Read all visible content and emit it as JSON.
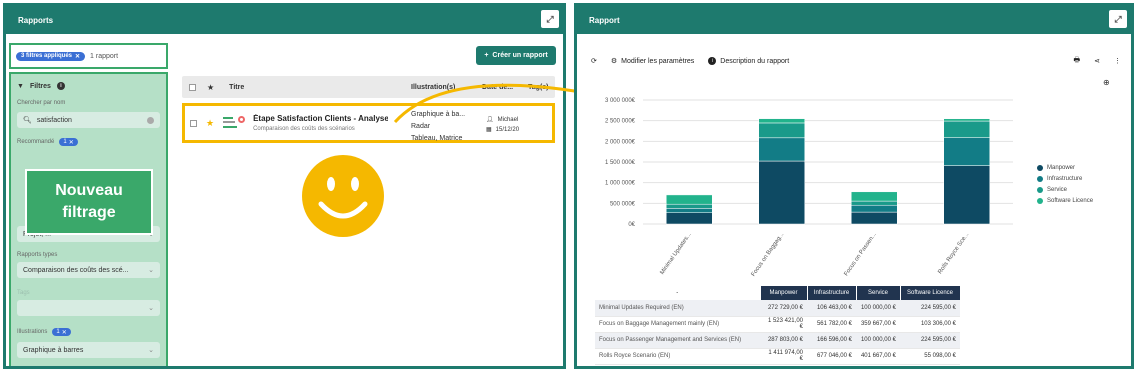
{
  "left_panel": {
    "title": "Rapports",
    "applied_filters_chip": "3 filtres appliqués",
    "report_count": "1 rapport",
    "create_button": "Créer un rapport",
    "filters": {
      "title": "Filtres",
      "search_by_name_label": "Chercher par nom",
      "search_value": "satisfaction",
      "recommended_label": "Recommandé",
      "recommended_badge": "1",
      "project_value": "Projet, ...",
      "report_types_label": "Rapports types",
      "report_types_value": "Comparaison des coûts des scé...",
      "tags_label": "Tags",
      "illustrations_label": "Illustrations",
      "illustrations_badge": "1",
      "illustrations_value": "Graphique à barres"
    },
    "table": {
      "headers": {
        "title": "Titre",
        "illustrations": "Illustration(s)",
        "date": "Date de...",
        "tags": "Tag(s)"
      },
      "row": {
        "title": "Étape Satisfaction Clients - Analyse",
        "subtitle": "Comparaison des coûts des scénarios",
        "illustrations": [
          "Graphique à ba...",
          "Radar",
          "Tableau, Matrice"
        ],
        "author": "Michael",
        "date": "15/12/20"
      }
    },
    "callout": {
      "line1": "Nouveau",
      "line2": "filtrage"
    }
  },
  "right_panel": {
    "title": "Rapport",
    "toolbar": {
      "modify_params": "Modifier les paramètres",
      "description": "Description du rapport"
    },
    "legend_names": [
      "Manpower",
      "Infrastructure",
      "Service",
      "Software Licence"
    ],
    "table": {
      "headers": [
        "Manpower",
        "Infrastructure",
        "Service",
        "Software Licence"
      ],
      "rows": [
        {
          "label": "Minimal Updates Required (EN)",
          "values": [
            "272 729,00 €",
            "106 463,00 €",
            "100 000,00 €",
            "224 595,00 €"
          ]
        },
        {
          "label": "Focus on Baggage Management mainly (EN)",
          "values": [
            "1 523 421,00 €",
            "561 782,00 €",
            "359 667,00 €",
            "103 306,00 €"
          ]
        },
        {
          "label": "Focus on Passenger Management and Services (EN)",
          "values": [
            "287 803,00 €",
            "166 596,00 €",
            "100 000,00 €",
            "224 595,00 €"
          ]
        },
        {
          "label": "Rolls Royce Scenario (EN)",
          "values": [
            "1 411 974,00 €",
            "677 046,00 €",
            "401 667,00 €",
            "55 098,00 €"
          ]
        }
      ]
    }
  },
  "chart_data": {
    "type": "bar",
    "stacked": true,
    "categories": [
      "Minimal Updates...",
      "Focus on Baggag...",
      "Focus on Passen...",
      "Rolls Royce Sce..."
    ],
    "series": [
      {
        "name": "Manpower",
        "values": [
          272729,
          1523421,
          287803,
          1411974
        ]
      },
      {
        "name": "Infrastructure",
        "values": [
          106463,
          561782,
          166596,
          677046
        ]
      },
      {
        "name": "Service",
        "values": [
          100000,
          359667,
          100000,
          401667
        ]
      },
      {
        "name": "Software Licence",
        "values": [
          224595,
          103306,
          224595,
          55098
        ]
      }
    ],
    "ylim": [
      0,
      3000000
    ],
    "yticks": [
      "0€",
      "500 000€",
      "1 000 000€",
      "1 500 000€",
      "2 000 000€",
      "2 500 000€",
      "3 000 000€"
    ],
    "legend": "right",
    "colors": {
      "Manpower": "#0e4a63",
      "Infrastructure": "#127c86",
      "Service": "#1a9a8a",
      "Software Licence": "#22b38c"
    }
  },
  "colors": {
    "frame": "#1e7a6e",
    "highlight": "#f5b800",
    "chip": "#3b6fd4",
    "filter_bg": "#b5e0c7"
  }
}
